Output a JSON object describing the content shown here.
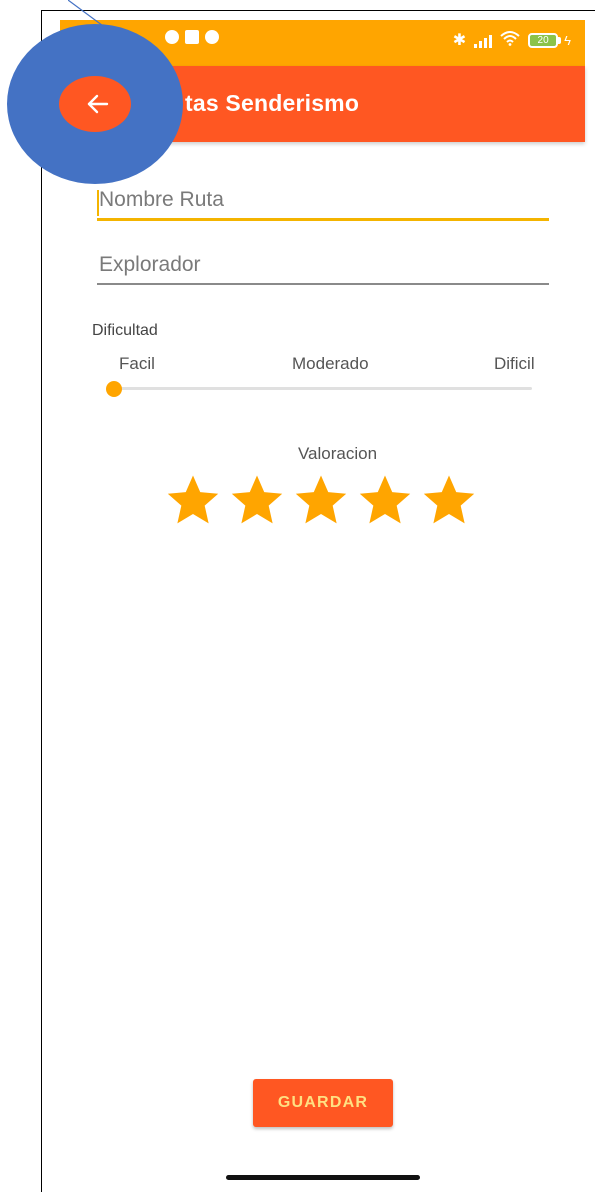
{
  "status_bar": {
    "battery_level": "20",
    "color": "#FFA500"
  },
  "app_bar": {
    "title": "tas Senderismo",
    "color": "#FF5722",
    "back_icon": "arrow-left-icon"
  },
  "form": {
    "nombre_ruta": {
      "placeholder": "Nombre Ruta",
      "value": ""
    },
    "explorador": {
      "placeholder": "Explorador",
      "value": ""
    }
  },
  "dificultad": {
    "label": "Dificultad",
    "ticks": [
      "Facil",
      "Moderado",
      "Dificil"
    ],
    "selected": "Facil",
    "value": 0
  },
  "valoracion": {
    "label": "Valoracion",
    "rating": 5,
    "max": 5,
    "star_color": "#FFA500"
  },
  "actions": {
    "save_label": "GUARDAR"
  },
  "annotation": {
    "color": "#4472C4"
  }
}
